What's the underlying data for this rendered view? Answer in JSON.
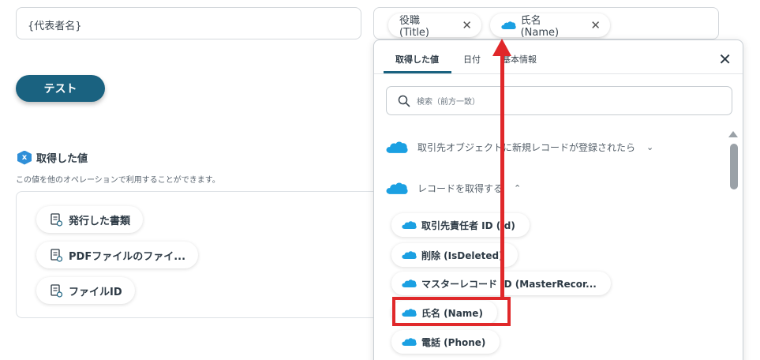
{
  "rep_input": {
    "value": "{代表者名}"
  },
  "tags": [
    {
      "label": "役職 (Title)",
      "remove": "✕"
    },
    {
      "label": "氏名 (Name)",
      "remove": "✕"
    }
  ],
  "test_button": {
    "label": "テスト"
  },
  "values_panel": {
    "badge": "x",
    "title": "取得した値",
    "description": "この値を他のオペレーションで利用することができます。",
    "items": [
      {
        "label": "発行した書類"
      },
      {
        "label": "PDFファイルのファイ..."
      },
      {
        "label": "ファイルID"
      }
    ]
  },
  "popup": {
    "tabs": [
      {
        "label": "取得した値",
        "active": true
      },
      {
        "label": "日付",
        "active": false
      },
      {
        "label": "基本情報",
        "active": false
      }
    ],
    "close": "✕",
    "search": {
      "placeholder": "検索（前方一致）"
    },
    "sections": [
      {
        "label": "取引先オブジェクトに新規レコードが登録されたら",
        "chevron": "⌄"
      },
      {
        "label": "レコードを取得する",
        "chevron": "⌃"
      }
    ],
    "items": [
      {
        "label": "取引先責任者 ID (Id)"
      },
      {
        "label": "削除 (IsDeleted)"
      },
      {
        "label": "マスターレコード ID (MasterRecor..."
      },
      {
        "label": "氏名 (Name)"
      },
      {
        "label": "電話 (Phone)"
      }
    ]
  },
  "colors": {
    "accent": "#1a6280",
    "salesforce": "#1ba0e2",
    "annotation": "#e0282a"
  }
}
